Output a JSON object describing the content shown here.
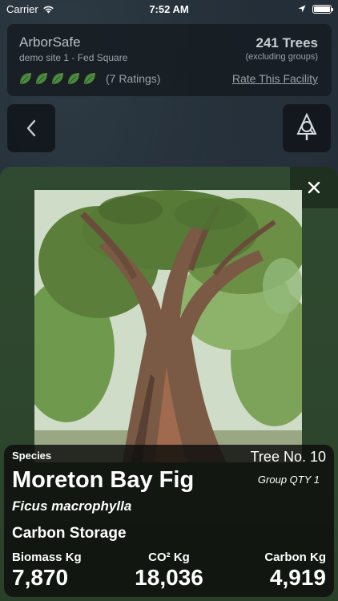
{
  "status_bar": {
    "carrier": "Carrier",
    "time": "7:52 AM"
  },
  "info_card": {
    "app_name": "ArborSafe",
    "site_name": "demo site 1 - Fed Square",
    "tree_count": "241 Trees",
    "tree_count_note": "(excluding groups)",
    "rating_leaves": 5,
    "ratings_label": "(7 Ratings)",
    "rate_link": "Rate This Facility"
  },
  "tree": {
    "species_label": "Species",
    "tree_number": "Tree No. 10",
    "common_name": "Moreton Bay Fig",
    "group_qty": "Group QTY 1",
    "scientific_name": "Ficus macrophylla",
    "carbon_heading": "Carbon Storage",
    "metrics": [
      {
        "label": "Biomass Kg",
        "value": "7,870"
      },
      {
        "label": "CO² Kg",
        "value": "18,036"
      },
      {
        "label": "Carbon Kg",
        "value": "4,919"
      }
    ]
  },
  "colors": {
    "sheet_green": "#2f4a30",
    "leaf_green": "#4c8a3c",
    "dark_overlay": "#0c0e0c"
  },
  "icons": {
    "back": "chevron-left-icon",
    "tree_finder": "tree-search-icon",
    "close": "close-icon",
    "wifi": "wifi-icon",
    "location": "location-arrow-icon",
    "battery": "battery-icon"
  }
}
